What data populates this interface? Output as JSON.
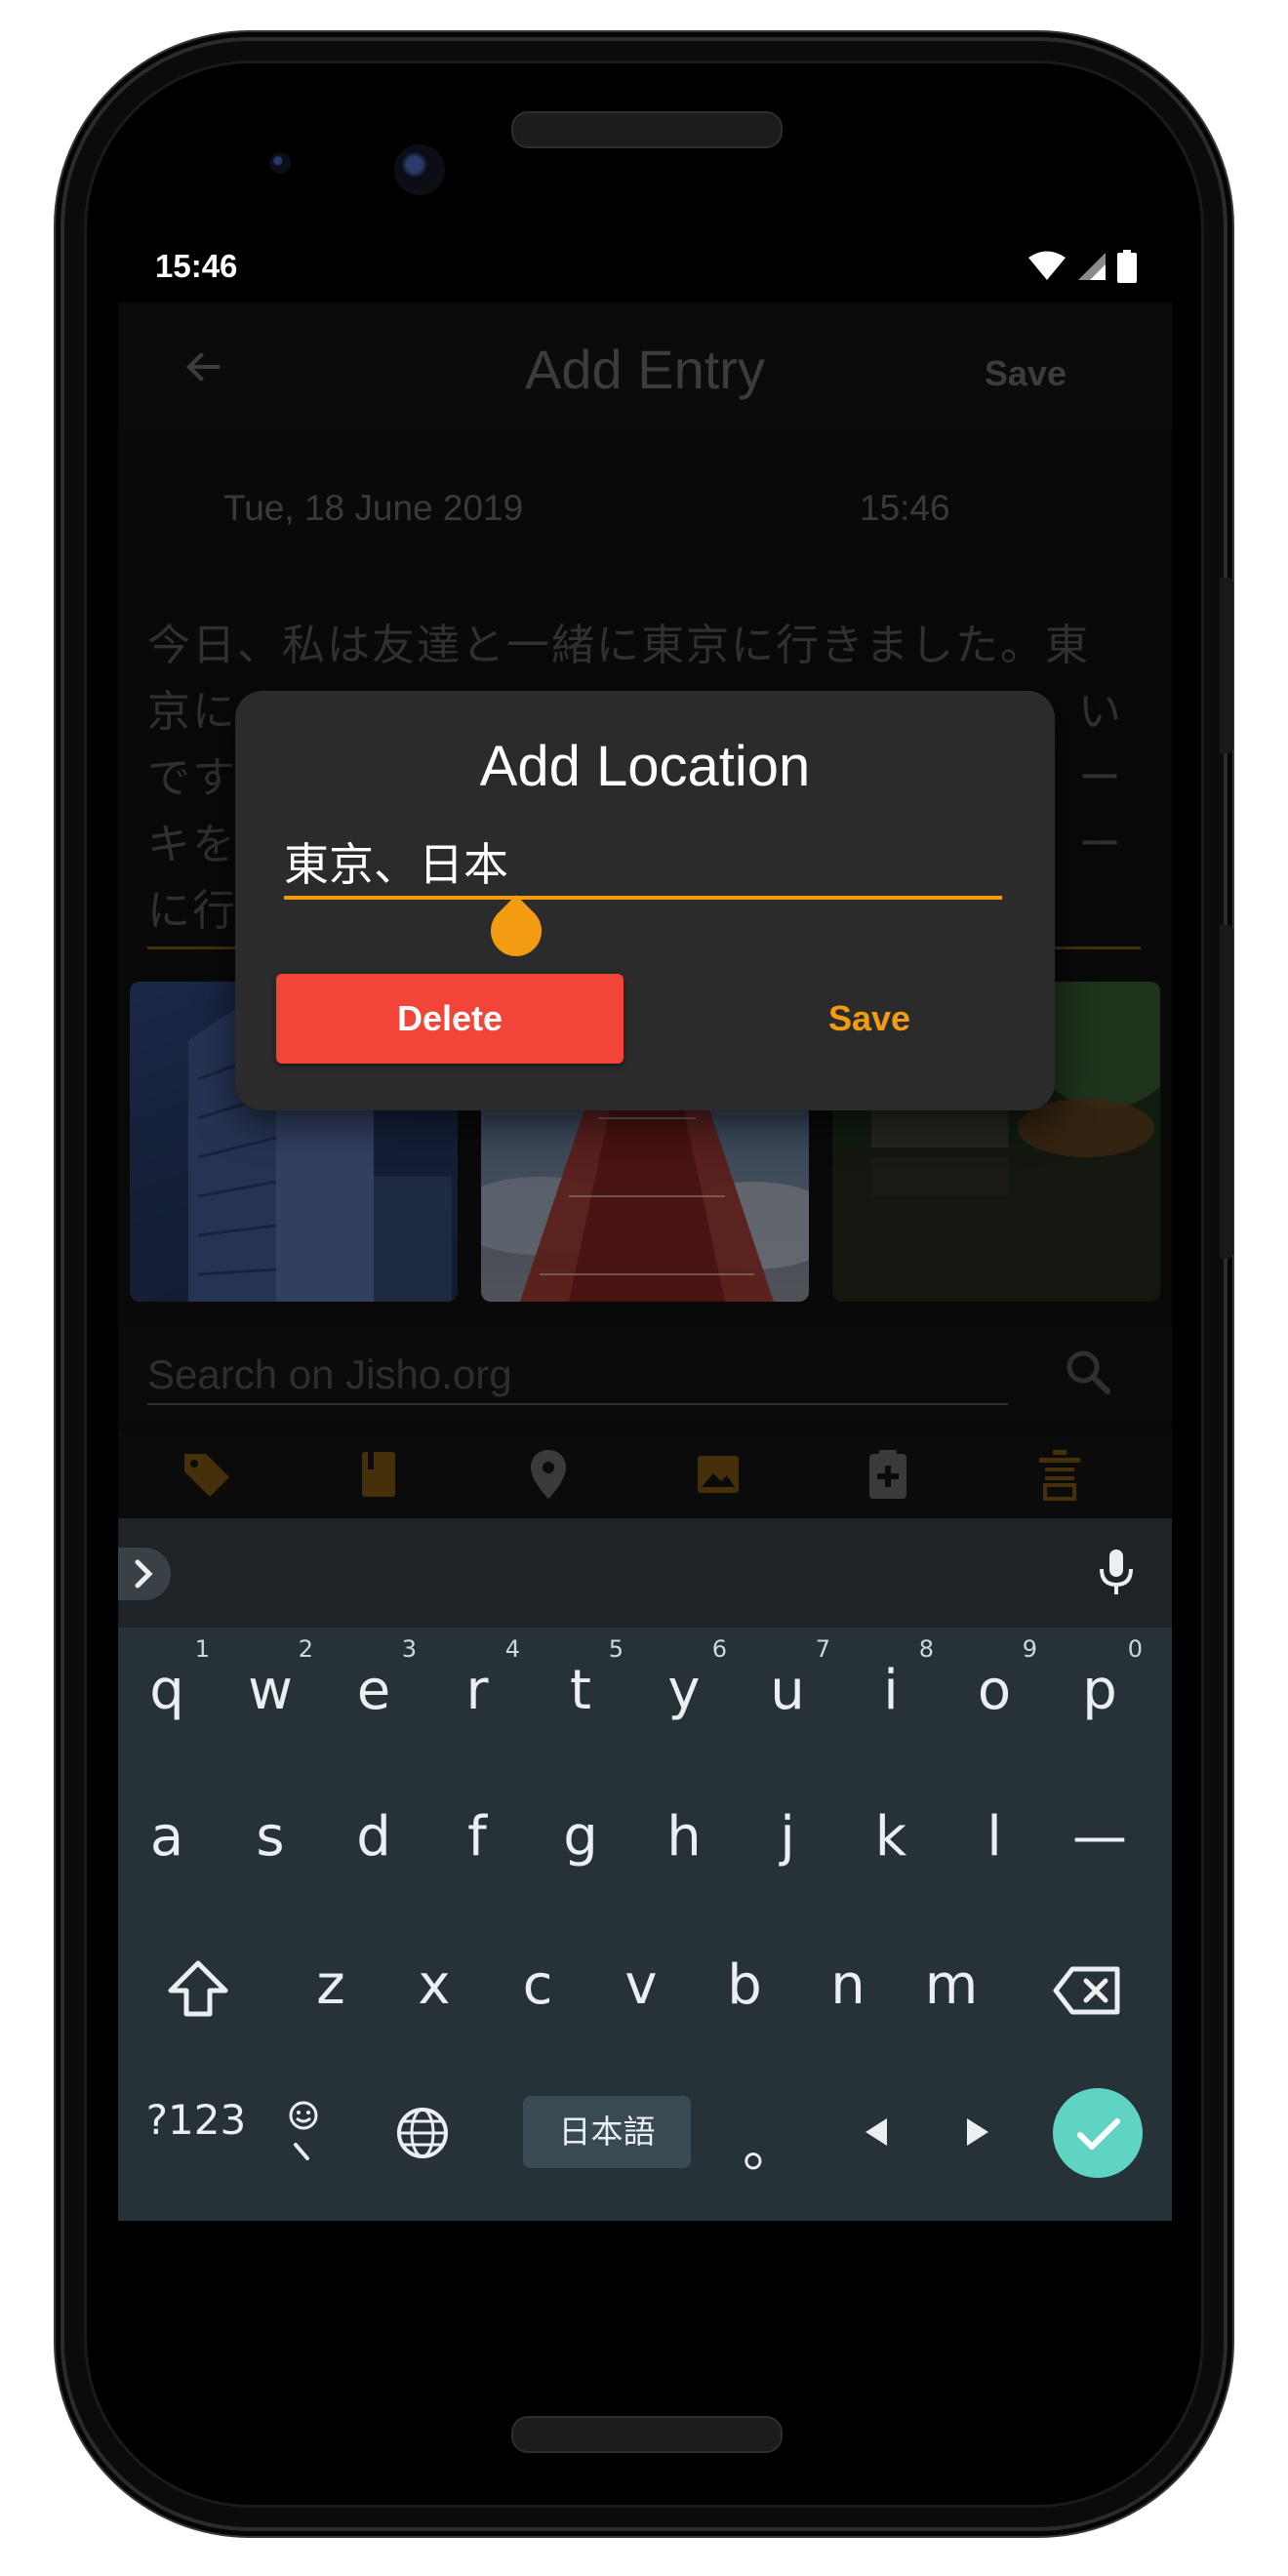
{
  "status_bar": {
    "time": "15:46",
    "icons": [
      "wifi-icon",
      "signal-icon",
      "battery-icon"
    ]
  },
  "app_bar": {
    "title": "Add Entry",
    "save_label": "Save",
    "back_icon": "arrow-left-icon"
  },
  "entry": {
    "date": "Tue, 18 June 2019",
    "time": "15:46",
    "text_lines": [
      "今日、私は友達と一緒に東京に行きました。東",
      "京に",
      "です",
      "キを",
      "に行"
    ],
    "text_lines_right": [
      "",
      "い",
      "ー",
      "ー",
      ""
    ]
  },
  "search": {
    "placeholder": "Search on Jisho.org"
  },
  "toolbar": {
    "icons": [
      "tag-icon",
      "book-icon",
      "location-pin-icon",
      "image-icon",
      "clipboard-add-icon",
      "kanji-icon"
    ],
    "accent": "#f39c12"
  },
  "dialog": {
    "title": "Add Location",
    "location_value": "東京、日本",
    "delete_label": "Delete",
    "save_label": "Save"
  },
  "keyboard": {
    "row1": [
      {
        "k": "q",
        "h": "1"
      },
      {
        "k": "w",
        "h": "2"
      },
      {
        "k": "e",
        "h": "3"
      },
      {
        "k": "r",
        "h": "4"
      },
      {
        "k": "t",
        "h": "5"
      },
      {
        "k": "y",
        "h": "6"
      },
      {
        "k": "u",
        "h": "7"
      },
      {
        "k": "i",
        "h": "8"
      },
      {
        "k": "o",
        "h": "9"
      },
      {
        "k": "p",
        "h": "0"
      }
    ],
    "row2": [
      "a",
      "s",
      "d",
      "f",
      "g",
      "h",
      "j",
      "k",
      "l",
      "—"
    ],
    "row3": [
      "z",
      "x",
      "c",
      "v",
      "b",
      "n",
      "m"
    ],
    "symbols_label": "?123",
    "language_label": "日本語",
    "punct_label": "。"
  },
  "colors": {
    "accent": "#f39c12",
    "delete": "#f24438",
    "keyboard_bg": "#263238",
    "dialog_bg": "#2b2b2b",
    "done_key": "#5fd3c4"
  }
}
